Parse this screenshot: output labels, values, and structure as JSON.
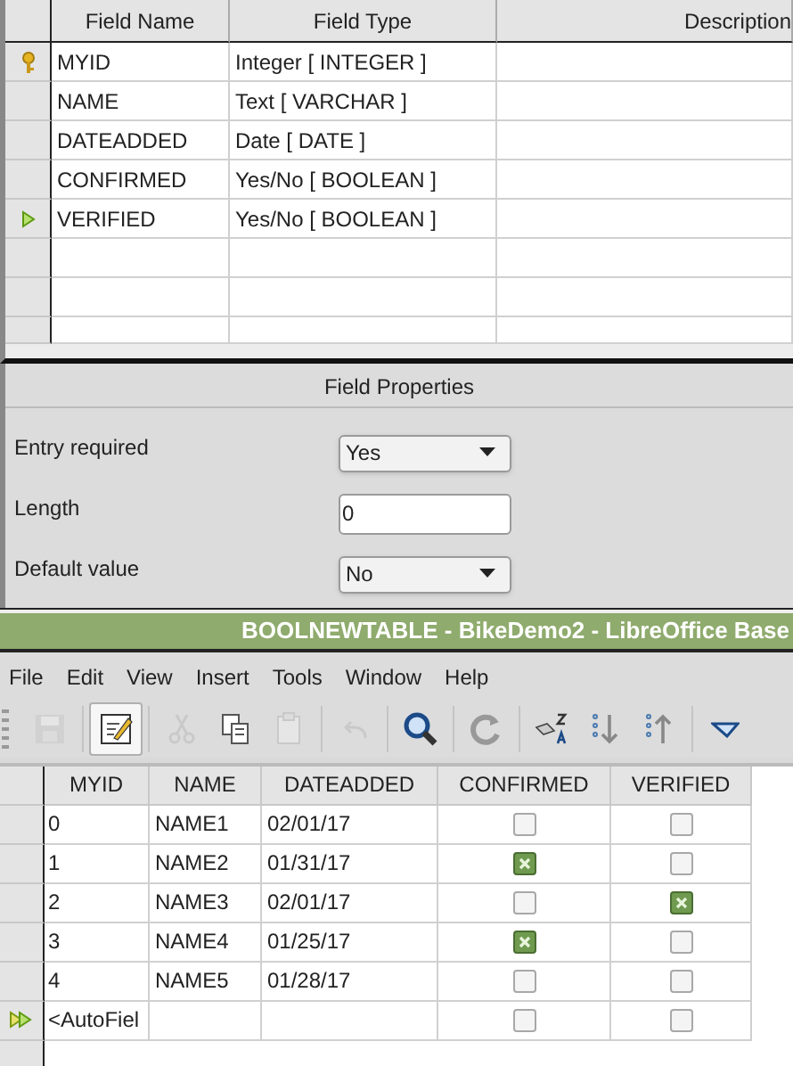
{
  "design_table": {
    "columns": [
      "Field Name",
      "Field Type",
      "Description"
    ],
    "rows": [
      {
        "primary_key": true,
        "current": false,
        "name": "MYID",
        "type": "Integer [ INTEGER ]"
      },
      {
        "primary_key": false,
        "current": false,
        "name": "NAME",
        "type": "Text [ VARCHAR ]"
      },
      {
        "primary_key": false,
        "current": false,
        "name": "DATEADDED",
        "type": "Date [ DATE ]"
      },
      {
        "primary_key": false,
        "current": false,
        "name": "CONFIRMED",
        "type": "Yes/No [ BOOLEAN ]"
      },
      {
        "primary_key": false,
        "current": true,
        "name": "VERIFIED",
        "type": "Yes/No [ BOOLEAN ]"
      }
    ]
  },
  "field_properties": {
    "title": "Field Properties",
    "rows": [
      {
        "kind": "dropdown",
        "label": "Entry required",
        "value": "Yes"
      },
      {
        "kind": "text",
        "label": "Length",
        "value": "0"
      },
      {
        "kind": "dropdown",
        "label": "Default value",
        "value": "No"
      }
    ]
  },
  "window": {
    "title": "BOOLNEWTABLE - BikeDemo2 - LibreOffice Base"
  },
  "menu": [
    "File",
    "Edit",
    "View",
    "Insert",
    "Tools",
    "Window",
    "Help"
  ],
  "toolbar": [
    {
      "kind": "save",
      "disabled": true
    },
    {
      "kind": "sep"
    },
    {
      "kind": "edit",
      "pressed": true
    },
    {
      "kind": "sep"
    },
    {
      "kind": "cut",
      "disabled": true
    },
    {
      "kind": "copy",
      "disabled": false
    },
    {
      "kind": "paste",
      "disabled": true
    },
    {
      "kind": "sep"
    },
    {
      "kind": "undo",
      "disabled": true
    },
    {
      "kind": "sep"
    },
    {
      "kind": "find",
      "disabled": false
    },
    {
      "kind": "sep"
    },
    {
      "kind": "refresh",
      "disabled": false
    },
    {
      "kind": "sep"
    },
    {
      "kind": "sort",
      "disabled": false
    },
    {
      "kind": "sortdown",
      "disabled": false
    },
    {
      "kind": "sortup",
      "disabled": false
    },
    {
      "kind": "sep"
    },
    {
      "kind": "filter",
      "disabled": false
    }
  ],
  "data_table": {
    "columns": [
      "MYID",
      "NAME",
      "DATEADDED",
      "CONFIRMED",
      "VERIFIED"
    ],
    "rows": [
      {
        "new_row": false,
        "myid": "0",
        "name": "NAME1",
        "date": "02/01/17",
        "confirmed": false,
        "verified": false
      },
      {
        "new_row": false,
        "myid": "1",
        "name": "NAME2",
        "date": "01/31/17",
        "confirmed": true,
        "verified": false
      },
      {
        "new_row": false,
        "myid": "2",
        "name": "NAME3",
        "date": "02/01/17",
        "confirmed": false,
        "verified": true
      },
      {
        "new_row": false,
        "myid": "3",
        "name": "NAME4",
        "date": "01/25/17",
        "confirmed": true,
        "verified": false
      },
      {
        "new_row": false,
        "myid": "4",
        "name": "NAME5",
        "date": "01/28/17",
        "confirmed": false,
        "verified": false
      },
      {
        "new_row": true,
        "myid": "<AutoFiel",
        "name": "",
        "date": "",
        "confirmed": false,
        "verified": false
      }
    ]
  }
}
